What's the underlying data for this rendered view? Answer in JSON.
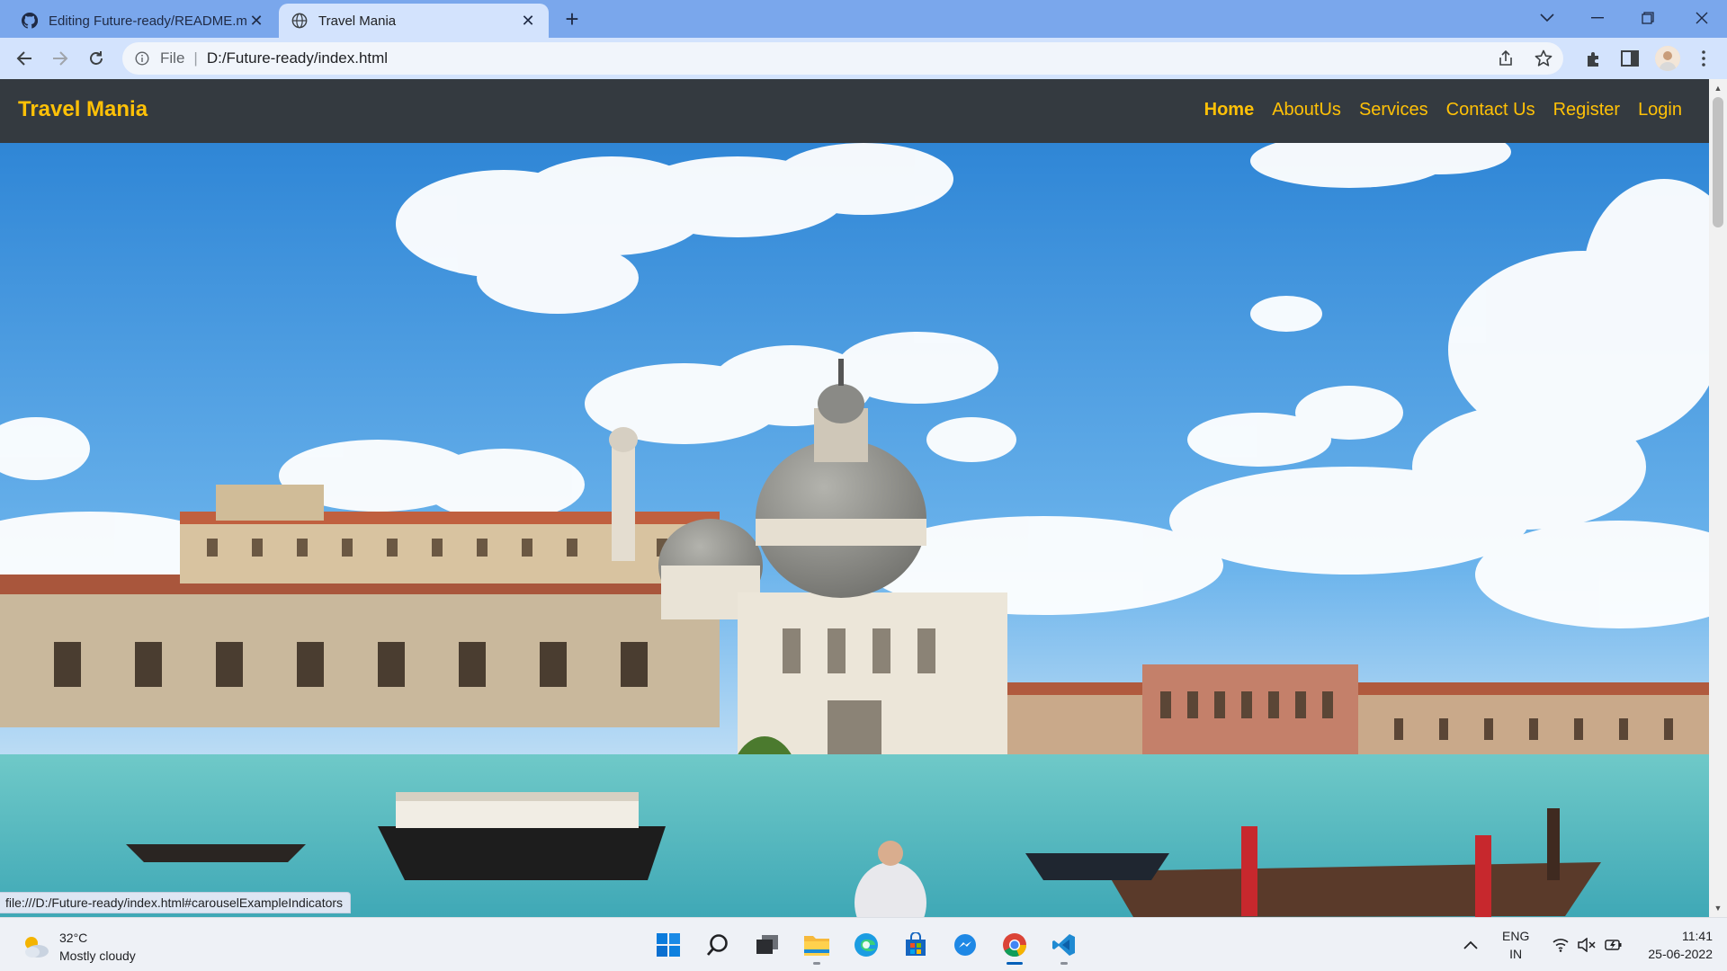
{
  "browser": {
    "tabs": [
      {
        "title": "Editing Future-ready/README.m",
        "icon": "github-icon",
        "active": false
      },
      {
        "title": "Travel Mania",
        "icon": "globe-icon",
        "active": true
      }
    ],
    "address": {
      "scheme": "File",
      "url": "D:/Future-ready/index.html"
    },
    "status_url": "file:///D:/Future-ready/index.html#carouselExampleIndicators"
  },
  "site": {
    "brand": "Travel Mania",
    "nav": [
      {
        "label": "Home",
        "active": true
      },
      {
        "label": "AboutUs"
      },
      {
        "label": "Services"
      },
      {
        "label": "Contact Us"
      },
      {
        "label": "Register"
      },
      {
        "label": "Login"
      }
    ],
    "hero_image": "venice-grand-canal-photo"
  },
  "taskbar": {
    "weather": {
      "temp": "32°C",
      "condition": "Mostly cloudy"
    },
    "apps": [
      "windows-start-icon",
      "search-icon",
      "task-view-icon",
      "file-explorer-icon",
      "edge-icon",
      "store-icon",
      "messenger-icon",
      "chrome-icon",
      "vscode-icon"
    ],
    "language": {
      "lang": "ENG",
      "region": "IN"
    },
    "clock": {
      "time": "11:41",
      "date": "25-06-2022"
    }
  },
  "colors": {
    "accent": "#ffc107",
    "navbar": "#343a40",
    "chrome": "#d3e3fd",
    "tabstrip": "#7aa7ec"
  }
}
